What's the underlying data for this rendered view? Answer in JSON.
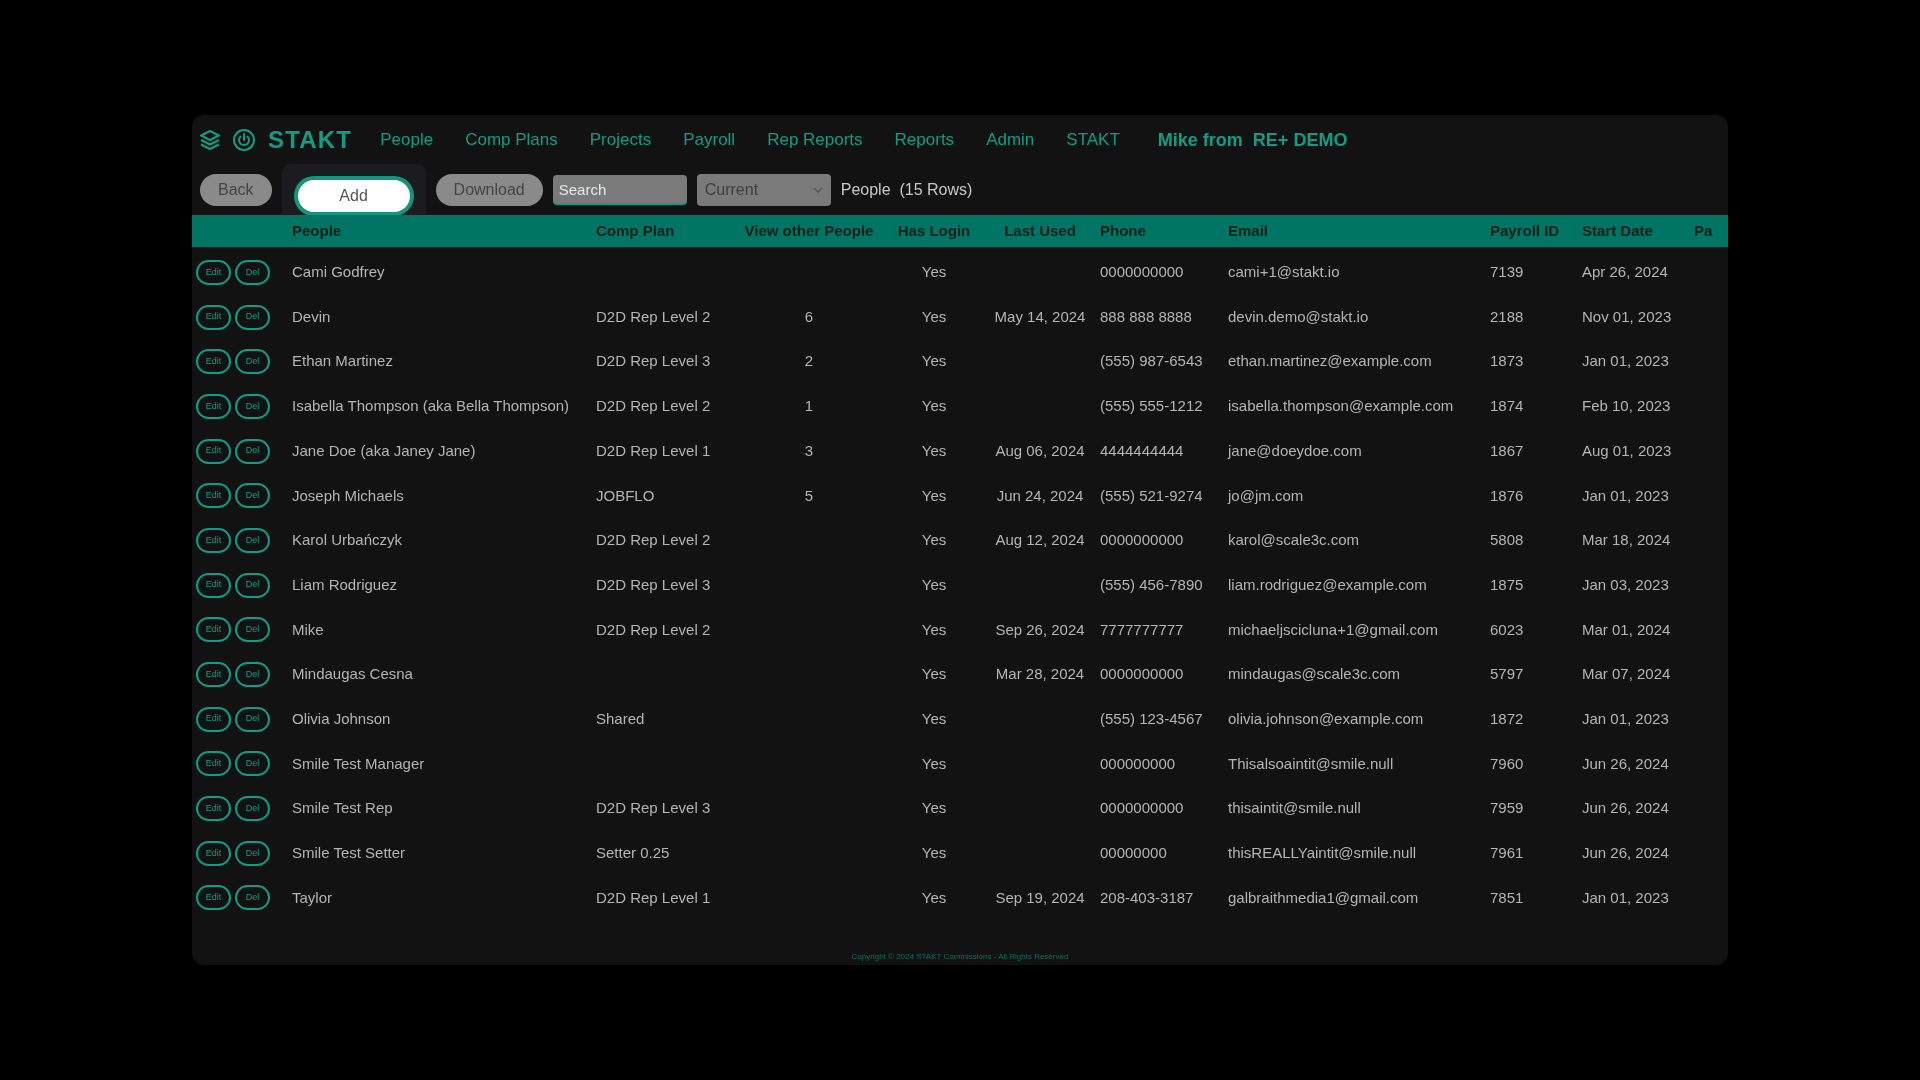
{
  "app": {
    "logo_text": "STAKT"
  },
  "nav": [
    {
      "label": "People"
    },
    {
      "label": "Comp Plans"
    },
    {
      "label": "Projects"
    },
    {
      "label": "Payroll"
    },
    {
      "label": "Rep Reports"
    },
    {
      "label": "Reports"
    },
    {
      "label": "Admin"
    },
    {
      "label": "STAKT"
    }
  ],
  "user": {
    "name": "Mike from",
    "org": "RE+ DEMO"
  },
  "toolbar": {
    "buttons": [
      {
        "label": "Back",
        "highlighted": false
      },
      {
        "label": "Add",
        "highlighted": true
      },
      {
        "label": "Download",
        "highlighted": false
      }
    ],
    "search": {
      "placeholder": "Search"
    },
    "filter": {
      "value": "Current"
    },
    "summary": "People  (15 Rows)"
  },
  "table": {
    "columns": [
      "People",
      "Comp Plan",
      "View other People",
      "Has Login",
      "Last Used",
      "Phone",
      "Email",
      "Payroll ID",
      "Start Date",
      "Pa"
    ],
    "rows": [
      {
        "actions": [
          "Edit",
          "Del"
        ],
        "cells": [
          "Cami Godfrey",
          "",
          "",
          "Yes",
          "",
          "0000000000",
          "cami+1@stakt.io",
          "7139",
          "Apr 26, 2024"
        ]
      },
      {
        "actions": [
          "Edit",
          "Del"
        ],
        "cells": [
          "Devin",
          "D2D Rep Level 2",
          "6",
          "Yes",
          "May 14, 2024",
          "888 888 8888",
          "devin.demo@stakt.io",
          "2188",
          "Nov 01, 2023"
        ]
      },
      {
        "actions": [
          "Edit",
          "Del"
        ],
        "cells": [
          "Ethan Martinez",
          "D2D Rep Level 3",
          "2",
          "Yes",
          "",
          "(555) 987-6543",
          "ethan.martinez@example.com",
          "1873",
          "Jan 01, 2023"
        ]
      },
      {
        "actions": [
          "Edit",
          "Del"
        ],
        "cells": [
          "Isabella Thompson (aka Bella Thompson)",
          "D2D Rep Level 2",
          "1",
          "Yes",
          "",
          "(555) 555-1212",
          "isabella.thompson@example.com",
          "1874",
          "Feb 10, 2023"
        ]
      },
      {
        "actions": [
          "Edit",
          "Del"
        ],
        "cells": [
          "Jane Doe (aka Janey Jane)",
          "D2D Rep Level 1",
          "3",
          "Yes",
          "Aug 06, 2024",
          "4444444444",
          "jane@doeydoe.com",
          "1867",
          "Aug 01, 2023"
        ]
      },
      {
        "actions": [
          "Edit",
          "Del"
        ],
        "cells": [
          "Joseph Michaels",
          "JOBFLO",
          "5",
          "Yes",
          "Jun 24, 2024",
          "(555) 521-9274",
          "jo@jm.com",
          "1876",
          "Jan 01, 2023"
        ]
      },
      {
        "actions": [
          "Edit",
          "Del"
        ],
        "cells": [
          "Karol Urbańczyk",
          "D2D Rep Level 2",
          "",
          "Yes",
          "Aug 12, 2024",
          "0000000000",
          "karol@scale3c.com",
          "5808",
          "Mar 18, 2024"
        ]
      },
      {
        "actions": [
          "Edit",
          "Del"
        ],
        "cells": [
          "Liam Rodriguez",
          "D2D Rep Level 3",
          "",
          "Yes",
          "",
          "(555) 456-7890",
          "liam.rodriguez@example.com",
          "1875",
          "Jan 03, 2023"
        ]
      },
      {
        "actions": [
          "Edit",
          "Del"
        ],
        "cells": [
          "Mike",
          "D2D Rep Level 2",
          "",
          "Yes",
          "Sep 26, 2024",
          "7777777777",
          "michaeljscicluna+1@gmail.com",
          "6023",
          "Mar 01, 2024"
        ]
      },
      {
        "actions": [
          "Edit",
          "Del"
        ],
        "cells": [
          "Mindaugas Cesna",
          "",
          "",
          "Yes",
          "Mar 28, 2024",
          "0000000000",
          "mindaugas@scale3c.com",
          "5797",
          "Mar 07, 2024"
        ]
      },
      {
        "actions": [
          "Edit",
          "Del"
        ],
        "cells": [
          "Olivia Johnson",
          "Shared",
          "",
          "Yes",
          "",
          "(555) 123-4567",
          "olivia.johnson@example.com",
          "1872",
          "Jan 01, 2023"
        ]
      },
      {
        "actions": [
          "Edit",
          "Del"
        ],
        "cells": [
          "Smile Test Manager",
          "",
          "",
          "Yes",
          "",
          "000000000",
          "Thisalsoaintit@smile.null",
          "7960",
          "Jun 26, 2024"
        ]
      },
      {
        "actions": [
          "Edit",
          "Del"
        ],
        "cells": [
          "Smile Test Rep",
          "D2D Rep Level 3",
          "",
          "Yes",
          "",
          "0000000000",
          "thisaintit@smile.null",
          "7959",
          "Jun 26, 2024"
        ]
      },
      {
        "actions": [
          "Edit",
          "Del"
        ],
        "cells": [
          "Smile Test Setter",
          "Setter 0.25",
          "",
          "Yes",
          "",
          "00000000",
          "thisREALLYaintit@smile.null",
          "7961",
          "Jun 26, 2024"
        ]
      },
      {
        "actions": [
          "Edit",
          "Del"
        ],
        "cells": [
          "Taylor",
          "D2D Rep Level 1",
          "",
          "Yes",
          "Sep 19, 2024",
          "208-403-3187",
          "galbraithmedia1@gmail.com",
          "7851",
          "Jan 01, 2023"
        ]
      }
    ]
  },
  "footer": "Copyright © 2024 STAKT Commissions - All Rights Reserved"
}
